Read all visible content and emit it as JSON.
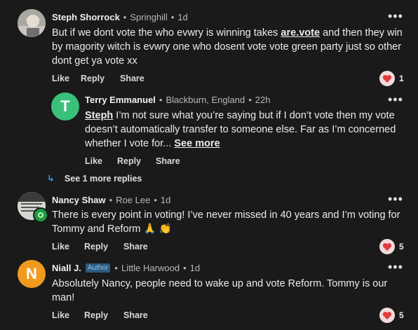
{
  "colors": {
    "background": "#1a1a1a",
    "heart": "#e33a3a",
    "terry_avatar": "#3ac07a",
    "niall_avatar": "#f29a1f"
  },
  "comments": [
    {
      "author": "Steph Shorrock",
      "location": "Springhill",
      "time": "1d",
      "text_before_link": "But if we dont vote the who evwry is winning takes ",
      "link": "are.vote",
      "text_after_link": " and then they win by magority witch is evwry one who dosent vote    vote green party just so other dont get ya vote xx",
      "actions": {
        "like": "Like",
        "reply": "Reply",
        "share": "Share"
      },
      "reaction_count": "1"
    },
    {
      "author": "Terry Emmanuel",
      "avatar_initial": "T",
      "location": "Blackburn, England",
      "time": "22h",
      "mention": "Steph",
      "text": " I’m not sure what you’re saying but if I don’t vote then my vote doesn’t automatically transfer to someone else.  Far as I’m concerned whether I vote for...",
      "see_more": "See more",
      "actions": {
        "like": "Like",
        "reply": "Reply",
        "share": "Share"
      }
    },
    {
      "author": "Nancy Shaw",
      "location": "Roe Lee",
      "time": "1d",
      "text": "There is every point in voting! I’ve never missed in 40 years and I’m voting for Tommy and Reform 🙏 👏",
      "actions": {
        "like": "Like",
        "reply": "Reply",
        "share": "Share"
      },
      "reaction_count": "5"
    },
    {
      "author": "Niall J.",
      "avatar_initial": "N",
      "badge": "Author",
      "location": "Little Harwood",
      "time": "1d",
      "text": "Absolutely Nancy, people need to wake up and vote Reform. Tommy is our man!",
      "actions": {
        "like": "Like",
        "reply": "Reply",
        "share": "Share"
      },
      "reaction_count": "5"
    }
  ],
  "see_replies": "See 1 more replies",
  "more_menu": "•••"
}
